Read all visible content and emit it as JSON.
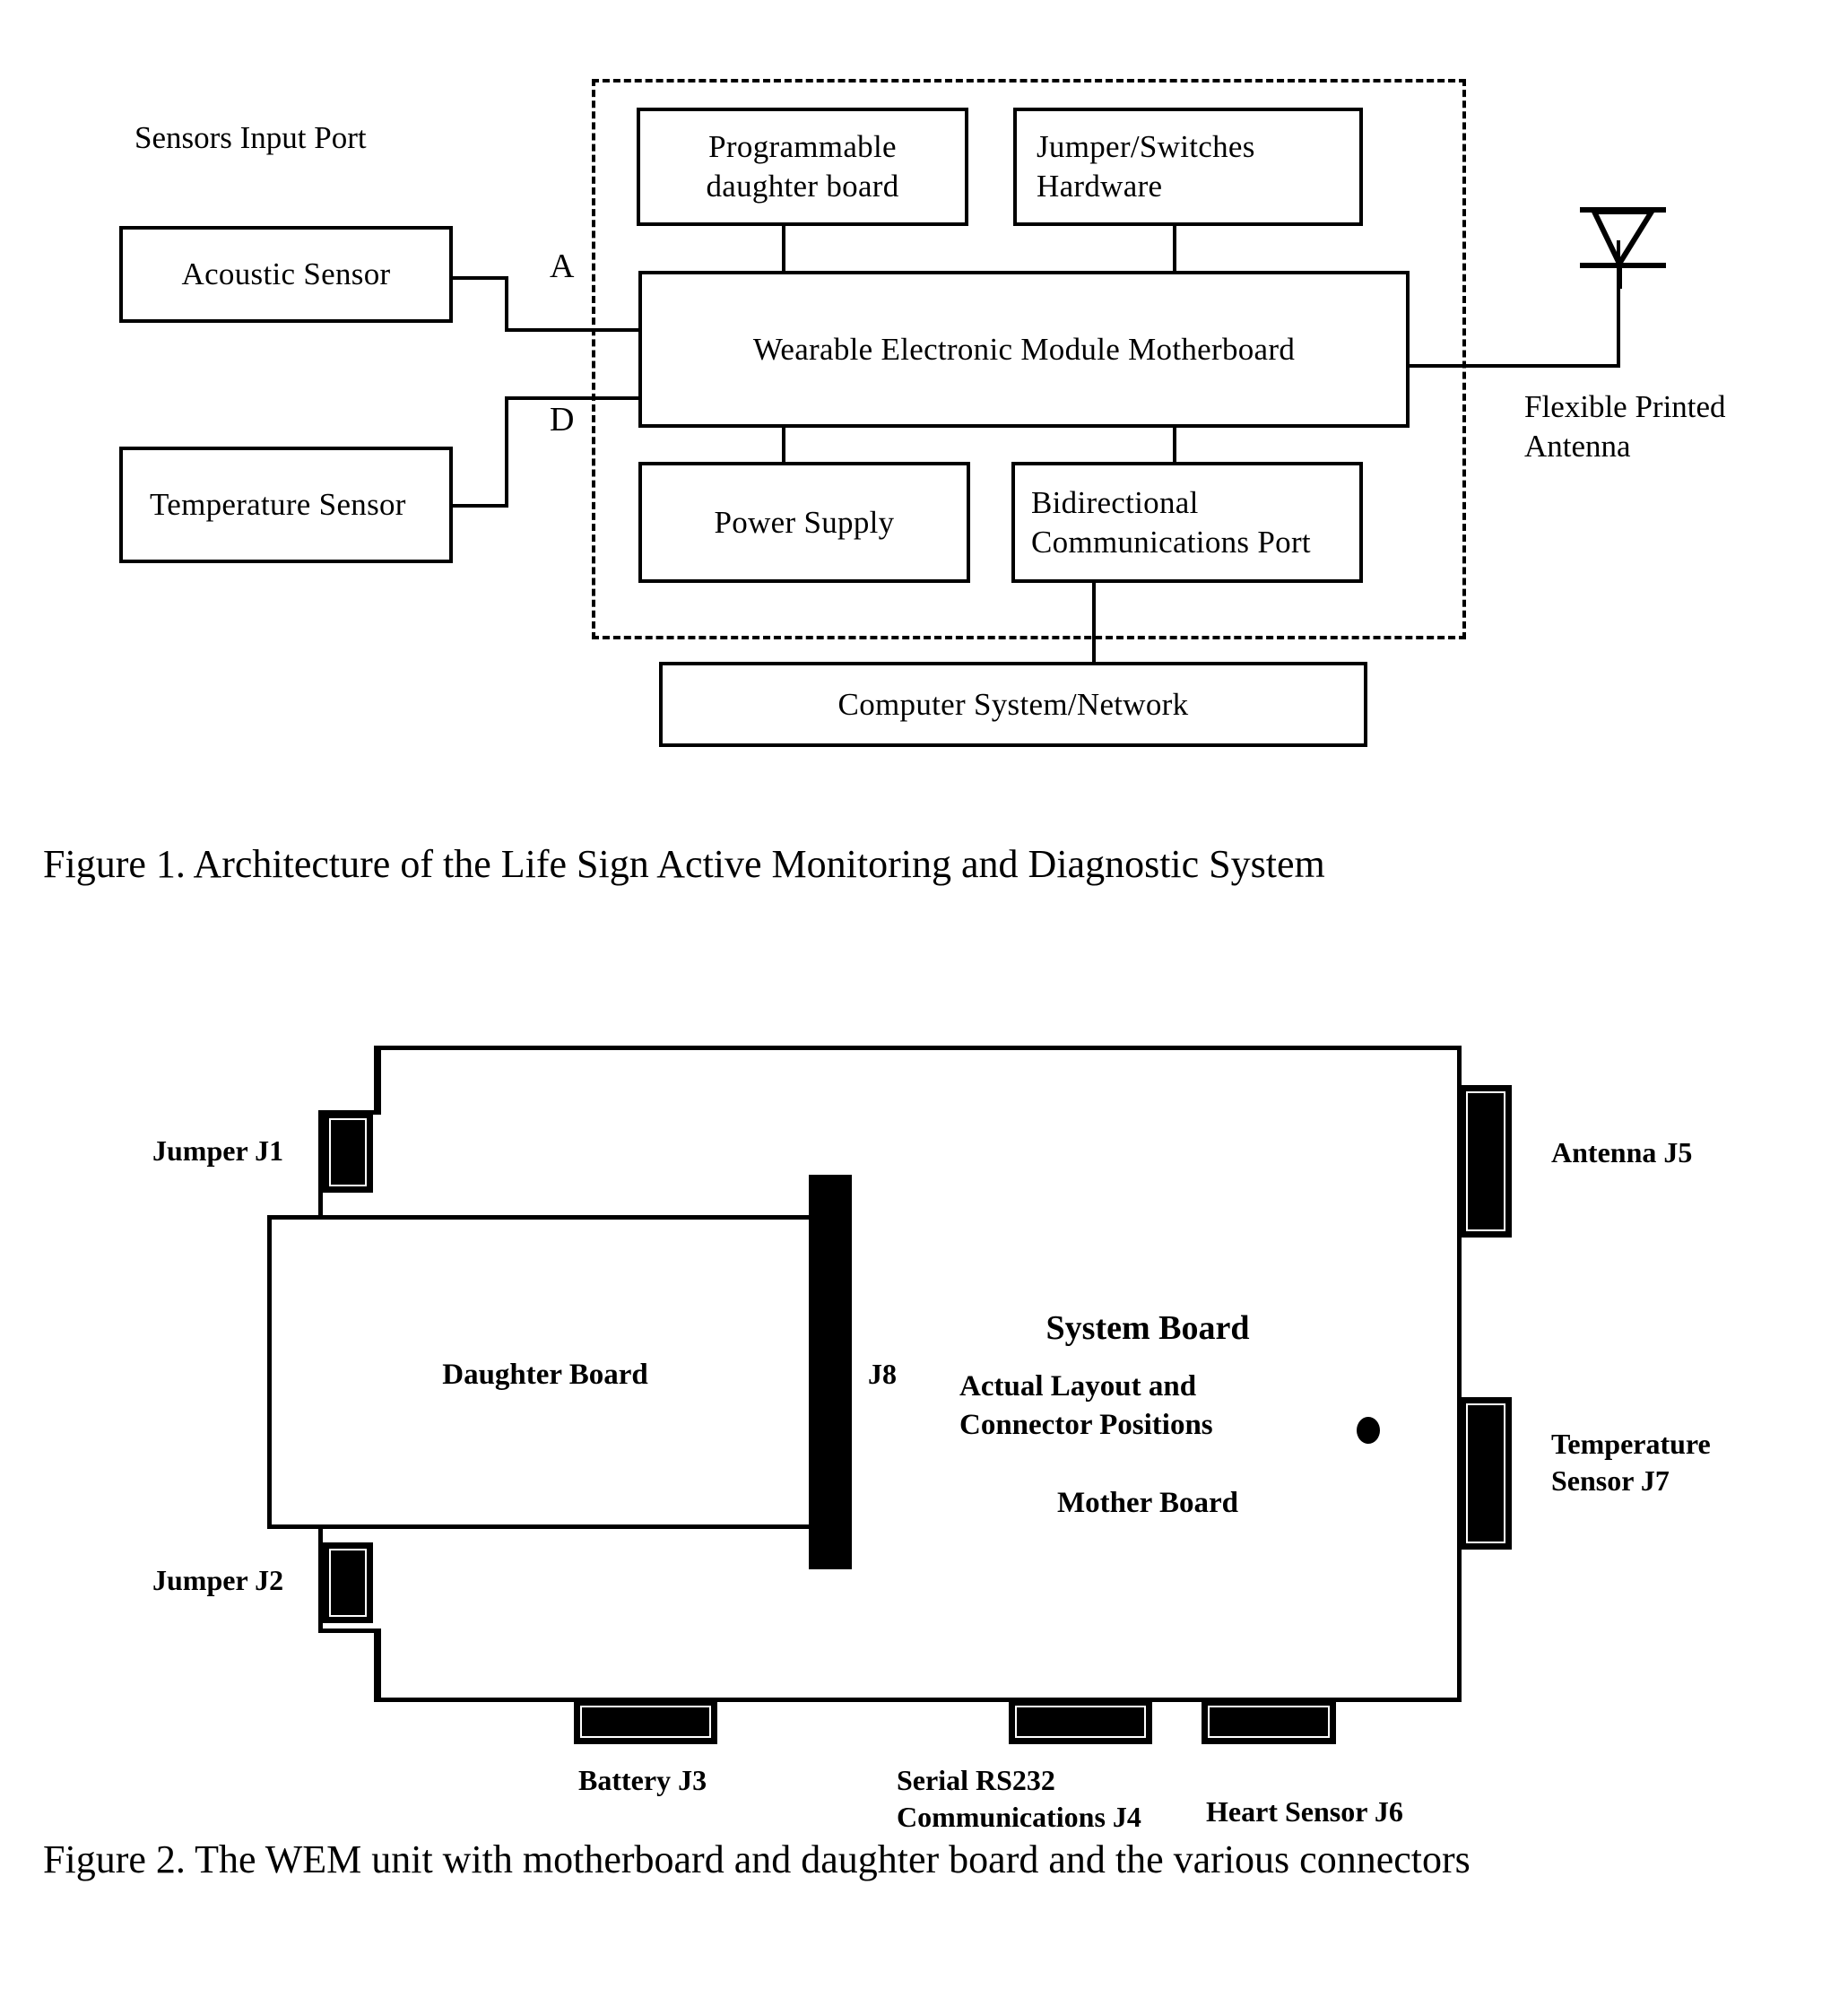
{
  "figure1": {
    "sensors_input_port_label": "Sensors Input Port",
    "acoustic_sensor": "Acoustic Sensor",
    "temperature_sensor": "Temperature\nSensor",
    "port_a_label": "A",
    "port_d_label": "D",
    "programmable_daughter_board": "Programmable\ndaughter board",
    "jumper_switches_hardware": "Jumper/Switches\nHardware",
    "wearable_electronic_module": "Wearable Electronic Module\nMotherboard",
    "power_supply": "Power Supply",
    "bidirectional_comm_port": "Bidirectional\nCommunications Port",
    "computer_system_network": "Computer System/Network",
    "flexible_printed_antenna": "Flexible Printed\nAntenna",
    "caption": "Figure 1. Architecture of the Life Sign Active Monitoring and Diagnostic System"
  },
  "figure2": {
    "jumper_j1": "Jumper J1",
    "jumper_j2": "Jumper J2",
    "daughter_board": "Daughter Board",
    "j8": "J8",
    "system_board": "System Board",
    "actual_layout": "Actual Layout and\nConnector Positions",
    "mother_board": "Mother Board",
    "antenna_j5": "Antenna J5",
    "temperature_sensor_j7": "Temperature\nSensor J7",
    "battery_j3": "Battery J3",
    "serial_rs232_j4": "Serial RS232\nCommunications J4",
    "heart_sensor_j6": "Heart Sensor  J6",
    "caption": "Figure 2. The WEM unit with motherboard and daughter board and the various connectors"
  },
  "colors": {
    "ink": "#000000",
    "paper": "#ffffff"
  }
}
